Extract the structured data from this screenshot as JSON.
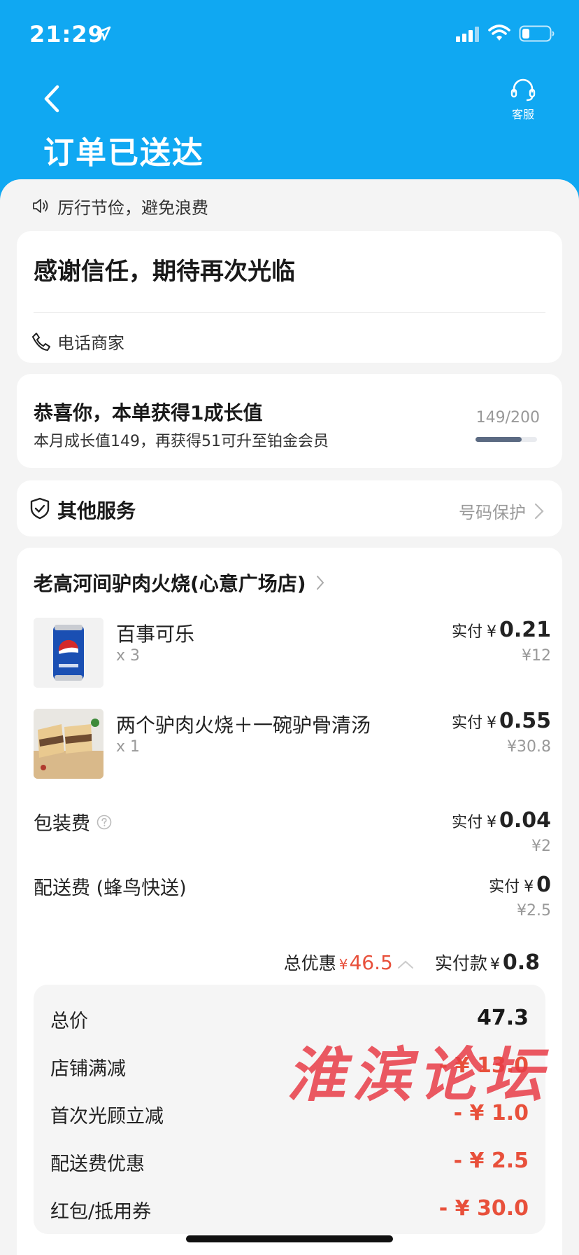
{
  "status_bar": {
    "time": "21:29"
  },
  "header": {
    "title": "订单已送达",
    "cs_label": "客服"
  },
  "notice": "厉行节俭，避免浪费",
  "thanks_card": {
    "title": "感谢信任，期待再次光临",
    "phone_label": "电话商家"
  },
  "growth_card": {
    "title": "恭喜你，本单获得1成长值",
    "subtitle": "本月成长值149，再获得51可升至铂金会员",
    "count": "149/200",
    "progress": 0.745
  },
  "services": {
    "title": "其他服务",
    "link": "号码保护"
  },
  "order": {
    "shop_name": "老高河间驴肉火烧(心意广场店)",
    "pay_label": "实付",
    "yen": "¥",
    "items": [
      {
        "name": "百事可乐",
        "qty": "x 3",
        "paid": "0.21",
        "original": "¥12"
      },
      {
        "name": "两个驴肉火烧＋一碗驴骨清汤",
        "qty": "x 1",
        "paid": "0.55",
        "original": "¥30.8"
      }
    ],
    "fees": [
      {
        "label": "包装费",
        "paid": "0.04",
        "original": "¥2"
      },
      {
        "label": "配送费 (蜂鸟快送)",
        "paid": "0",
        "original": "¥2.5"
      }
    ],
    "summary": {
      "discount_label": "总优惠",
      "discount": "46.5",
      "paid_label": "实付款",
      "paid": "0.8"
    },
    "breakdown": [
      {
        "label": "总价",
        "value": "47.3"
      },
      {
        "label": "店铺满减",
        "value": "- ¥ 13.0"
      },
      {
        "label": "首次光顾立减",
        "value": "- ¥ 1.0"
      },
      {
        "label": "配送费优惠",
        "value": "- ¥ 2.5"
      },
      {
        "label": "红包/抵用券",
        "value": "- ¥ 30.0"
      }
    ]
  },
  "watermark": "淮滨论坛",
  "colors": {
    "header_bg": "#10a8f2",
    "discount_red": "#e8503b",
    "progress": "#5b6a82"
  }
}
